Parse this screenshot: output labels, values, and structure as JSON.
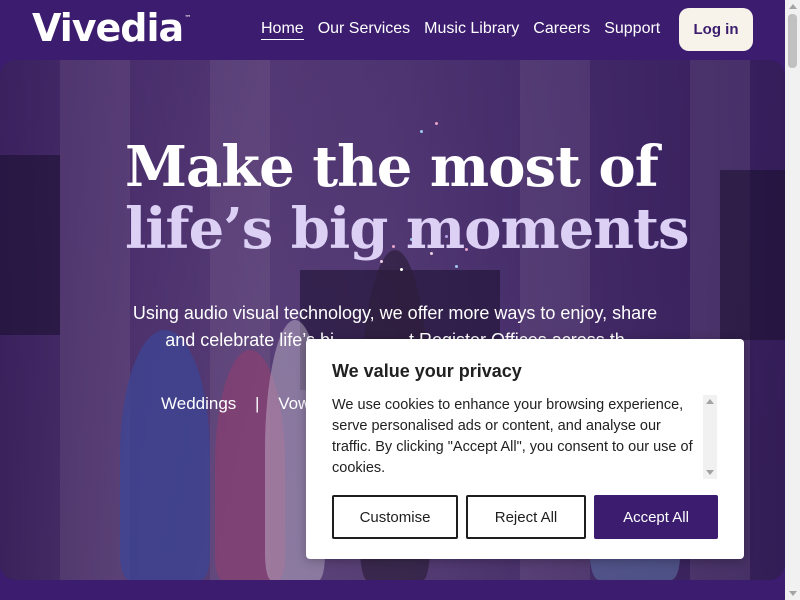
{
  "header": {
    "logo_text": "Vivedia",
    "logo_tm": "™",
    "nav": [
      {
        "label": "Home",
        "active": true
      },
      {
        "label": "Our Services"
      },
      {
        "label": "Music Library"
      },
      {
        "label": "Careers"
      },
      {
        "label": "Support"
      }
    ],
    "login_label": "Log in"
  },
  "hero": {
    "title_line1": "Make the most of",
    "title_line2": "life’s big moments",
    "subtitle_line1": "Using audio visual technology, we offer more ways to enjoy, share",
    "subtitle_line2": "and celebrate life’s bi",
    "subtitle_fragment": "t Register Offices across th",
    "links": [
      "Weddings",
      "Vow"
    ],
    "link_separator": "|"
  },
  "cookie_banner": {
    "title": "We value your privacy",
    "text": "We use cookies to enhance your browsing experience, serve personalised ads or content, and analyse our traffic. By clicking \"Accept All\", you consent to our use of cookies.",
    "buttons": {
      "customise": "Customise",
      "reject": "Reject All",
      "accept": "Accept All"
    }
  },
  "colors": {
    "brand_purple": "#3b1c6e",
    "login_bg": "#f7f3ea",
    "accent_text": "#dcd0f5"
  }
}
